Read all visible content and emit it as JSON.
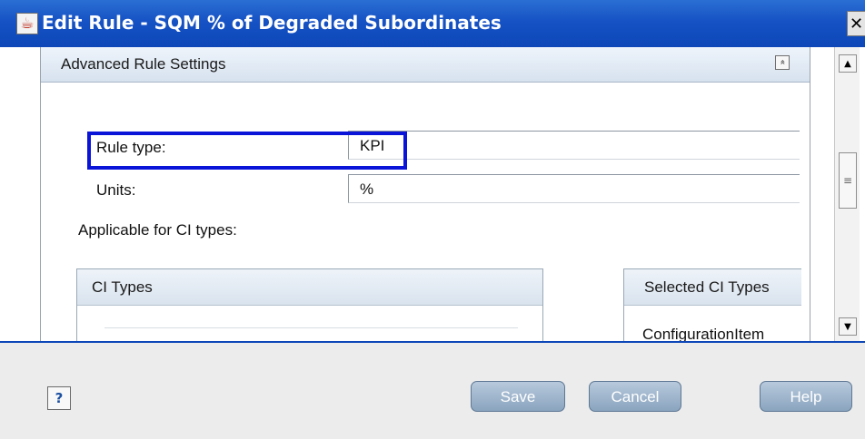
{
  "window": {
    "title": "Edit Rule - SQM % of Degraded Subordinates",
    "icon": "java-coffee-cup-icon",
    "close_glyph": "✕"
  },
  "section": {
    "title": "Advanced Rule Settings",
    "collapse_glyph": "«"
  },
  "fields": {
    "rule_type_label": "Rule type:",
    "rule_type_value": "KPI",
    "units_label": "Units:",
    "units_value": "%"
  },
  "applicable_label": "Applicable for CI types:",
  "ci_types_panel": {
    "header": "CI Types"
  },
  "selected_panel": {
    "header": "Selected CI Types",
    "items": [
      "ConfigurationItem"
    ]
  },
  "scrollbar": {
    "up_glyph": "▲",
    "down_glyph": "▼",
    "thumb_glyph": "≡"
  },
  "footer": {
    "help_icon_glyph": "?",
    "save_label": "Save",
    "cancel_label": "Cancel",
    "help_label": "Help"
  },
  "colors": {
    "titlebar": "#1652c4",
    "highlight": "#0a14d8",
    "button": "#9fb6ce"
  }
}
